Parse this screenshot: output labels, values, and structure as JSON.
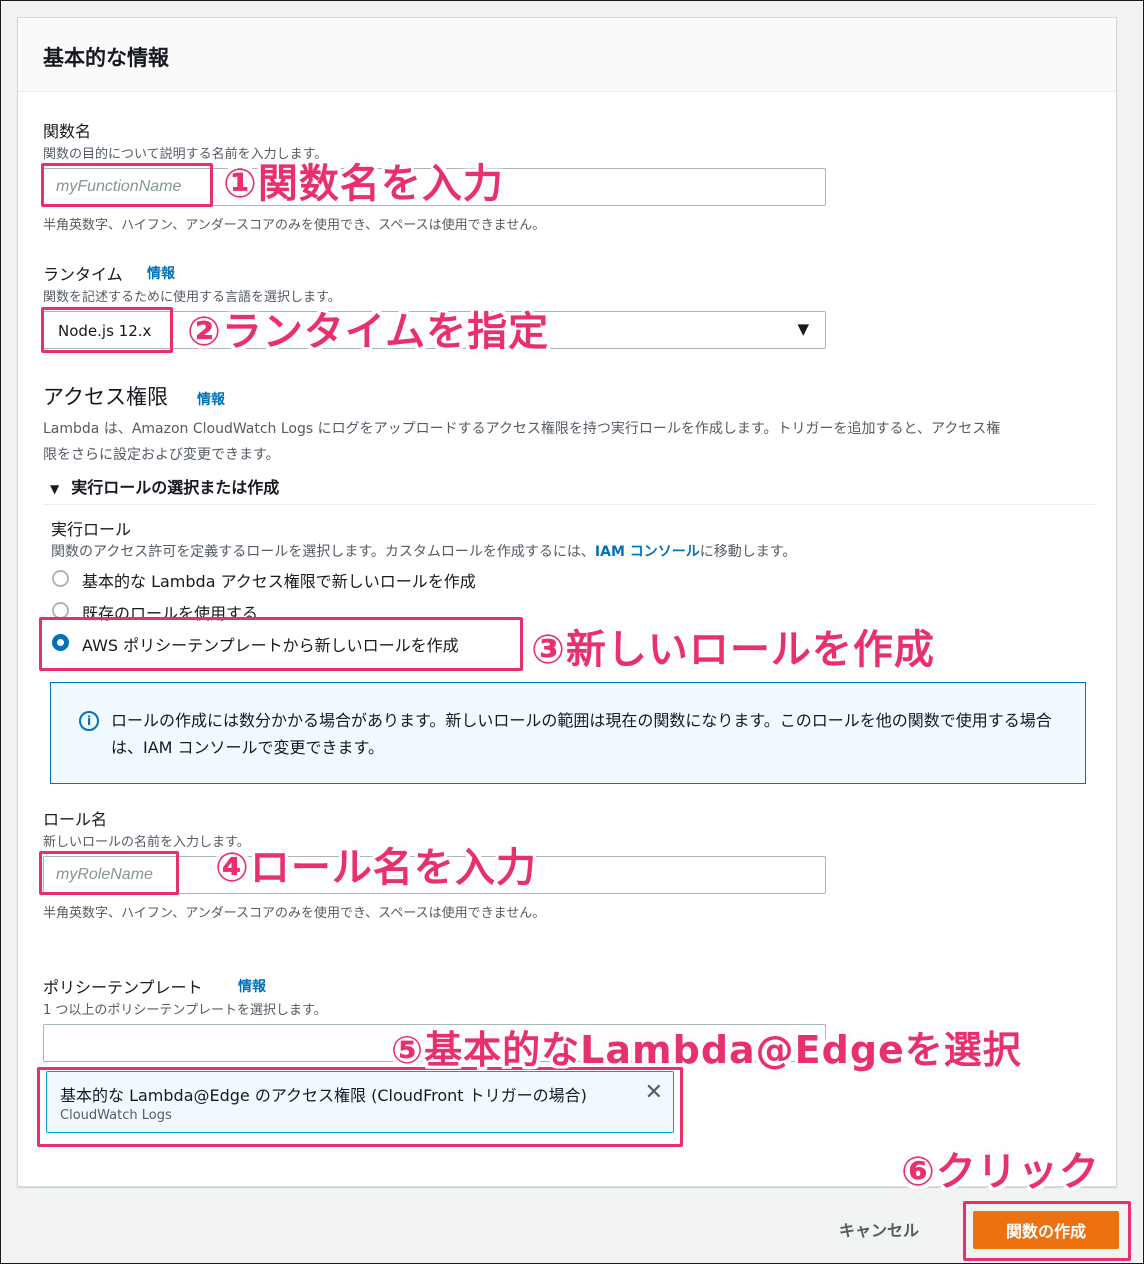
{
  "panel": {
    "title": "基本的な情報"
  },
  "function_name": {
    "label": "関数名",
    "description": "関数の目的について説明する名前を入力します。",
    "placeholder": "myFunctionName",
    "hint": "半角英数字、ハイフン、アンダースコアのみを使用でき、スペースは使用できません。"
  },
  "runtime": {
    "label": "ランタイム",
    "info": "情報",
    "description": "関数を記述するために使用する言語を選択します。",
    "value": "Node.js 12.x"
  },
  "permissions": {
    "title": "アクセス権限",
    "info": "情報",
    "description_line1": "Lambda は、Amazon CloudWatch Logs にログをアップロードするアクセス権限を持つ実行ロールを作成します。トリガーを追加すると、アクセス権",
    "description_line2": "限をさらに設定および変更できます。",
    "expander_label": "実行ロールの選択または作成"
  },
  "execution_role": {
    "label": "実行ロール",
    "description_before": "関数のアクセス許可を定義するロールを選択します。カスタムロールを作成するには、",
    "description_link": "IAM コンソール",
    "description_after": "に移動します。",
    "options": [
      {
        "label": "基本的な Lambda アクセス権限で新しいロールを作成",
        "selected": false
      },
      {
        "label": "既存のロールを使用する",
        "selected": false
      },
      {
        "label": "AWS ポリシーテンプレートから新しいロールを作成",
        "selected": true
      }
    ]
  },
  "alert": {
    "icon": "info-icon",
    "text": "ロールの作成には数分かかる場合があります。新しいロールの範囲は現在の関数になります。このロールを他の関数で使用する場合は、IAM コンソールで変更できます。"
  },
  "role_name": {
    "label": "ロール名",
    "description": "新しいロールの名前を入力します。",
    "placeholder": "myRoleName",
    "hint": "半角英数字、ハイフン、アンダースコアのみを使用でき、スペースは使用できません。"
  },
  "policy_templates": {
    "label": "ポリシーテンプレート",
    "info": "情報",
    "description": "1 つ以上のポリシーテンプレートを選択します。",
    "search_value": "",
    "selected_token": {
      "title": "基本的な Lambda@Edge のアクセス権限 (CloudFront トリガーの場合)",
      "subtitle": "CloudWatch Logs",
      "close_icon": "✕"
    }
  },
  "footer": {
    "cancel_label": "キャンセル",
    "create_label": "関数の作成"
  },
  "annotations": {
    "step1": "①関数名を入力",
    "step2": "②ランタイムを指定",
    "step3": "③新しいロールを作成",
    "step4": "④ロール名を入力",
    "step5": "⑤基本的なLambda@Edgeを選択",
    "step6": "⑥クリック"
  },
  "colors": {
    "accent_blue": "#0073bb",
    "primary_orange": "#ec7211",
    "annotation_pink": "#e8306e"
  }
}
